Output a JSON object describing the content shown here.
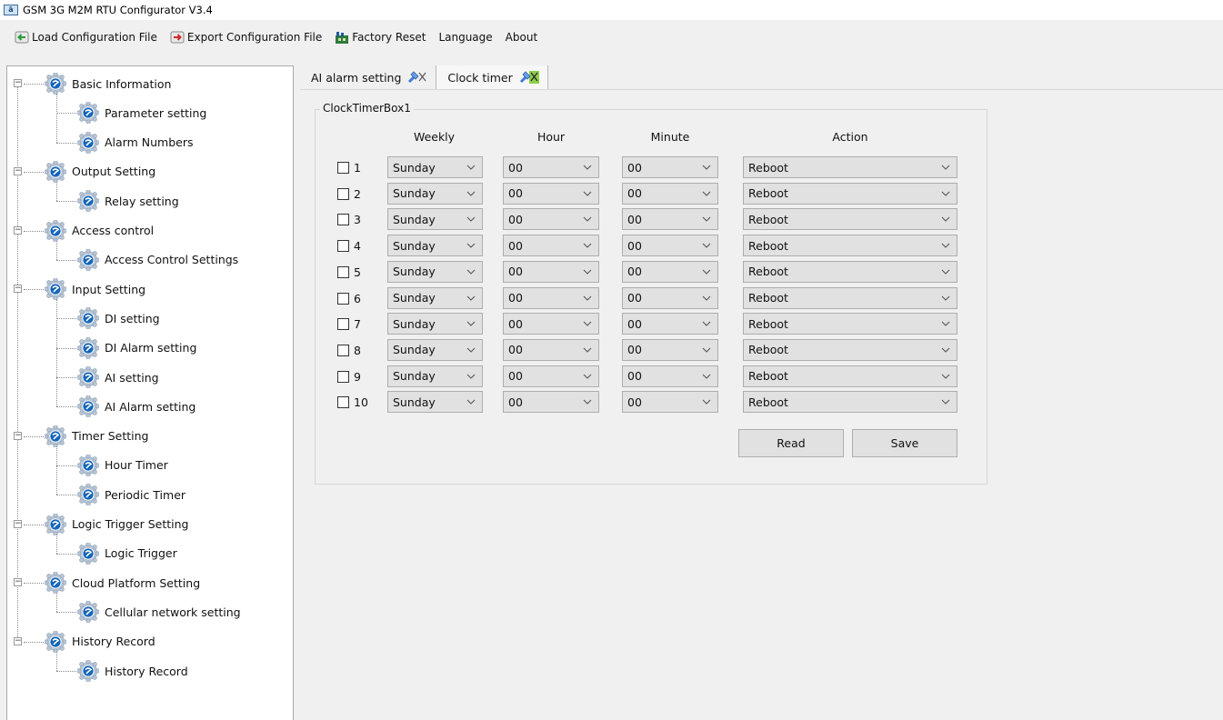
{
  "window": {
    "title": "GSM 3G M2M RTU Configurator V3.4"
  },
  "menu": {
    "load": "Load Configuration File",
    "export": "Export Configuration File",
    "reset": "Factory Reset",
    "language": "Language",
    "about": "About"
  },
  "tree": {
    "groups": [
      {
        "label": "Basic Information",
        "children": [
          "Parameter setting",
          "Alarm Numbers"
        ]
      },
      {
        "label": "Output Setting",
        "children": [
          "Relay setting"
        ]
      },
      {
        "label": "Access control",
        "children": [
          "Access Control Settings"
        ]
      },
      {
        "label": "Input Setting",
        "children": [
          "DI setting",
          "DI Alarm setting",
          "AI setting",
          "AI Alarm setting"
        ]
      },
      {
        "label": "Timer Setting",
        "children": [
          "Hour Timer",
          "Periodic Timer"
        ]
      },
      {
        "label": "Logic Trigger Setting",
        "children": [
          "Logic Trigger"
        ]
      },
      {
        "label": "Cloud Platform Setting",
        "children": [
          "Cellular network setting"
        ]
      },
      {
        "label": "History Record",
        "children": [
          "History Record"
        ]
      }
    ]
  },
  "tabs": [
    {
      "label": "AI alarm setting"
    },
    {
      "label": "Clock timer"
    }
  ],
  "clock": {
    "group_title": "ClockTimerBox1",
    "headers": {
      "weekly": "Weekly",
      "hour": "Hour",
      "minute": "Minute",
      "action": "Action"
    },
    "rows": [
      {
        "label": "1",
        "weekly": "Sunday",
        "hour": "00",
        "minute": "00",
        "action": "Reboot"
      },
      {
        "label": "2",
        "weekly": "Sunday",
        "hour": "00",
        "minute": "00",
        "action": "Reboot"
      },
      {
        "label": "3",
        "weekly": "Sunday",
        "hour": "00",
        "minute": "00",
        "action": "Reboot"
      },
      {
        "label": "4",
        "weekly": "Sunday",
        "hour": "00",
        "minute": "00",
        "action": "Reboot"
      },
      {
        "label": "5",
        "weekly": "Sunday",
        "hour": "00",
        "minute": "00",
        "action": "Reboot"
      },
      {
        "label": "6",
        "weekly": "Sunday",
        "hour": "00",
        "minute": "00",
        "action": "Reboot"
      },
      {
        "label": "7",
        "weekly": "Sunday",
        "hour": "00",
        "minute": "00",
        "action": "Reboot"
      },
      {
        "label": "8",
        "weekly": "Sunday",
        "hour": "00",
        "minute": "00",
        "action": "Reboot"
      },
      {
        "label": "9",
        "weekly": "Sunday",
        "hour": "00",
        "minute": "00",
        "action": "Reboot"
      },
      {
        "label": "10",
        "weekly": "Sunday",
        "hour": "00",
        "minute": "00",
        "action": "Reboot"
      }
    ],
    "read_label": "Read",
    "save_label": "Save"
  },
  "colors": {
    "gear_blue": "#1466b8",
    "gear_ring": "#b8c6d6",
    "combo_bg": "#e1e1e1",
    "tree_bg": "#ffffff"
  },
  "icons": {
    "app": "app-icon",
    "load": "load-arrow-icon",
    "export": "export-arrow-icon",
    "reset": "factory-reset-icon",
    "tree_node": "gear-icon",
    "tab_close": "tab-close-icon",
    "dropdown": "chevron-down-icon"
  }
}
